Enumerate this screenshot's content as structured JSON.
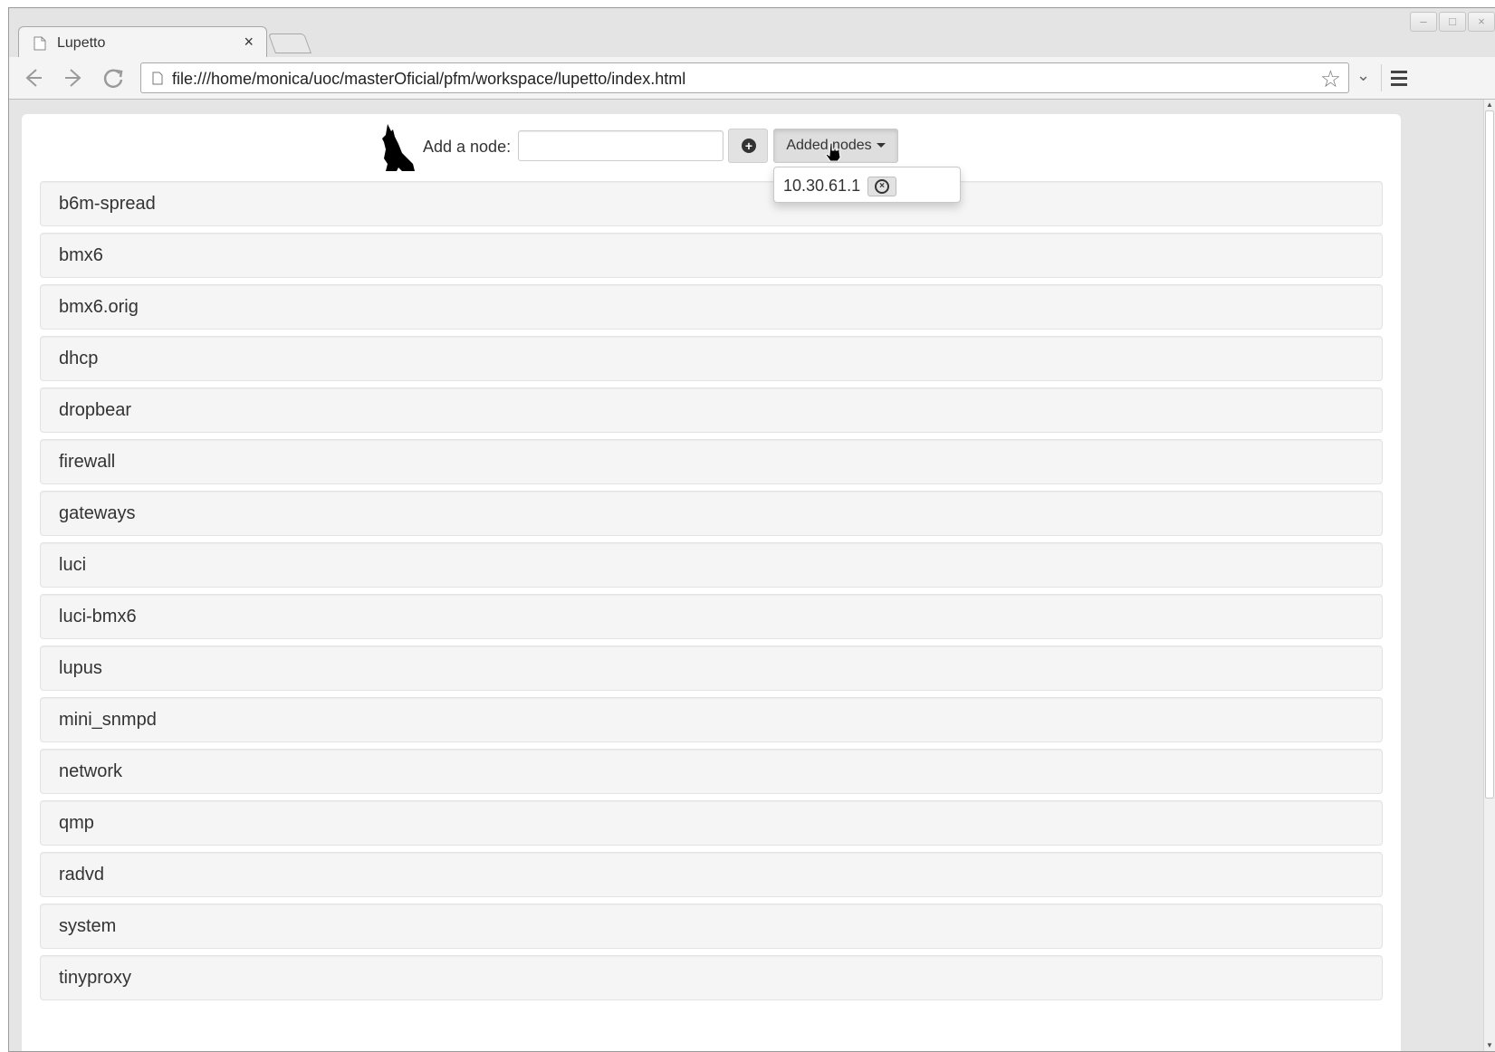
{
  "browser": {
    "tab_title": "Lupetto",
    "tab_close": "×",
    "url": "file:///home/monica/uoc/masterOficial/pfm/workspace/lupetto/index.html"
  },
  "window_controls": {
    "minimize": "–",
    "maximize": "□",
    "close": "×"
  },
  "header": {
    "add_label": "Add a node:",
    "input_value": "",
    "add_button_symbol": "+",
    "added_nodes_label": "Added nodes"
  },
  "dropdown": {
    "nodes": [
      {
        "ip": "10.30.61.1"
      }
    ]
  },
  "packages": [
    "b6m-spread",
    "bmx6",
    "bmx6.orig",
    "dhcp",
    "dropbear",
    "firewall",
    "gateways",
    "luci",
    "luci-bmx6",
    "lupus",
    "mini_snmpd",
    "network",
    "qmp",
    "radvd",
    "system",
    "tinyproxy"
  ],
  "icons": {
    "back": "back-arrow-icon",
    "forward": "forward-arrow-icon",
    "reload": "reload-icon",
    "star": "bookmark-star-icon",
    "menu": "hamburger-menu-icon",
    "logo": "wolf-logo-icon"
  }
}
